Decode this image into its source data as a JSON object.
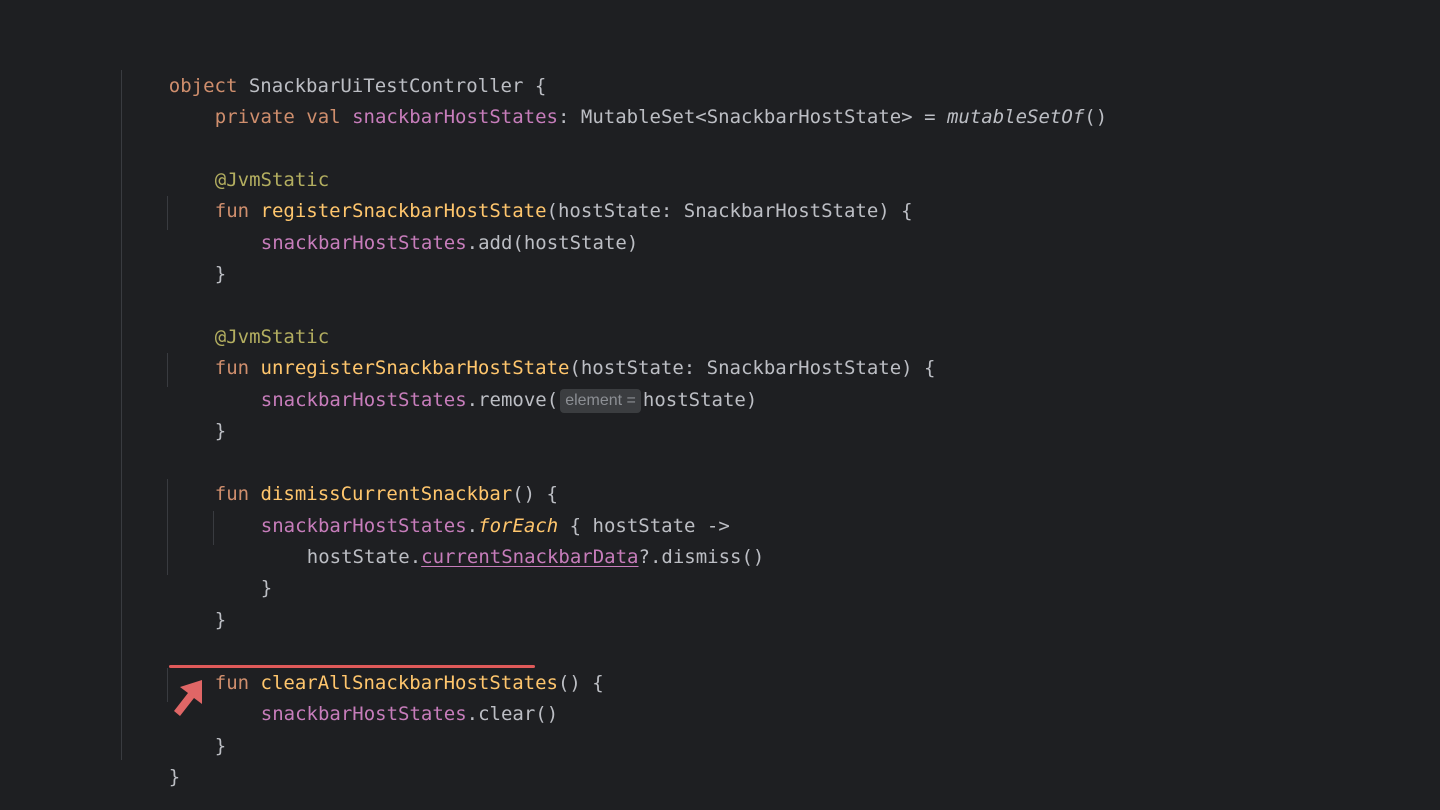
{
  "code": {
    "l1": {
      "kw": "object",
      "name": "SnackbarUiTestController",
      "brace": "{"
    },
    "l2": {
      "kw1": "private",
      "kw2": "val",
      "prop": "snackbarHostStates",
      "colon": ":",
      "type": "MutableSet<SnackbarHostState>",
      "eq": "=",
      "call": "mutableSetOf",
      "parens": "()"
    },
    "l4": {
      "anno": "@JvmStatic"
    },
    "l5": {
      "kw": "fun",
      "name": "registerSnackbarHostState",
      "params": "(hostState: SnackbarHostState) {"
    },
    "l6": {
      "prop": "snackbarHostStates",
      "rest": ".add(hostState)"
    },
    "l7": {
      "brace": "}"
    },
    "l9": {
      "anno": "@JvmStatic"
    },
    "l10": {
      "kw": "fun",
      "name": "unregisterSnackbarHostState",
      "params": "(hostState: SnackbarHostState) {"
    },
    "l11": {
      "prop": "snackbarHostStates",
      "call": ".remove(",
      "hint": "element =",
      "arg": "hostState)"
    },
    "l12": {
      "brace": "}"
    },
    "l14": {
      "kw": "fun",
      "name": "dismissCurrentSnackbar",
      "params": "() {"
    },
    "l15": {
      "prop": "snackbarHostStates",
      "dot": ".",
      "call": "forEach",
      "rest": " { hostState ->"
    },
    "l16": {
      "recv": "hostState.",
      "prop": "currentSnackbarData",
      "rest": "?.dismiss()"
    },
    "l17": {
      "brace": "}"
    },
    "l18": {
      "brace": "}"
    },
    "l20": {
      "kw": "fun",
      "name": "clearAllSnackbarHostStates",
      "parens": "()",
      "brace": " {"
    },
    "l21": {
      "prop": "snackbarHostStates",
      "rest": ".clear()"
    },
    "l22": {
      "brace": "}"
    },
    "l23": {
      "brace": "}"
    }
  },
  "colors": {
    "background": "#1e1f22",
    "keyword": "#cf8e6d",
    "function_declaration": "#ffc66d",
    "property": "#c77dbb",
    "annotation": "#b3ae60",
    "highlight": "#e05a5a"
  }
}
